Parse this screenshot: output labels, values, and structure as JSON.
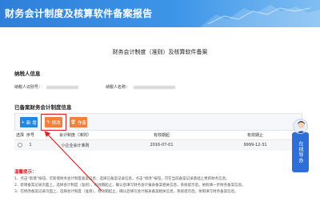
{
  "banner": {
    "title": "财务会计制度及核算软件备案报告"
  },
  "page": {
    "subtitle": "财务会计制度（准则）及核算软件备案"
  },
  "taxpayer_section": {
    "title": "纳税人信息",
    "id_label": "纳税人识别号：",
    "name_label": "纳税人名称："
  },
  "records_section": {
    "title": "已备案财务会计制度信息"
  },
  "toolbar": {
    "add_label": "新 增",
    "edit_label": "修改",
    "delete_label": "作废"
  },
  "table": {
    "columns": [
      "选择",
      "序号",
      "会计制度（准则）",
      "有效期起",
      "有效期止"
    ],
    "rows": [
      {
        "no": "1",
        "system": "小企业会计准则",
        "start": "2016-07-01",
        "end": "9999-12-31"
      }
    ]
  },
  "tips": {
    "title": "温馨提示：",
    "lines": [
      "1、点击“新增”按钮，可新增财务会计制度备案信息；选择已备案记录信息，点击“修改”按钮，可在当前备案记录基础上更新财务信息。",
      "2、新增备案记录页面上，选择会计制度（准则），有效期起止，确认后填写财务会计报表备案相关信息，系统提示后，依照填一步财务备案信息。",
      "3、在修改备案记录页面上，选择会计制度（准则），有效期起止，确认后填写会计报表备案相关信息，系统提示后，依照填写财务备案信息。"
    ]
  },
  "help": {
    "label": "在线导办"
  },
  "colors": {
    "banner": "#2f7fd8",
    "add_button": "#1e88e5",
    "edit_button": "#f0803a",
    "highlight": "#e02020"
  }
}
